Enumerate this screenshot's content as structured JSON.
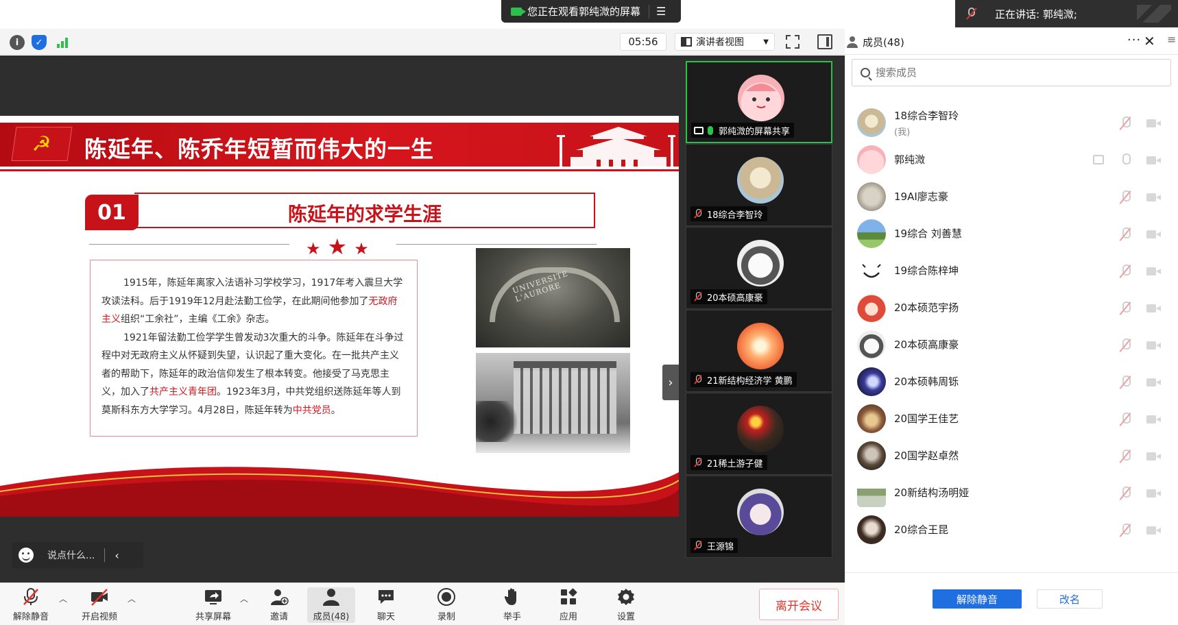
{
  "banner": {
    "viewing_text": "您正在观看郭纯溦的屏幕",
    "speaking_text": "正在讲话: 郭纯溦;"
  },
  "toolbar": {
    "timer": "05:56",
    "view_mode": "演讲者视图"
  },
  "members_panel": {
    "title": "成员(48)",
    "search_placeholder": "搜索成员",
    "members": [
      {
        "name": "18综合李智玲",
        "sub": "(我)"
      },
      {
        "name": "郭纯溦",
        "sub": ""
      },
      {
        "name": "19AI廖志豪",
        "sub": ""
      },
      {
        "name": "19综合 刘善慧",
        "sub": ""
      },
      {
        "name": "19综合陈梓坤",
        "sub": ""
      },
      {
        "name": "20本硕范宇扬",
        "sub": ""
      },
      {
        "name": "20本硕高康豪",
        "sub": ""
      },
      {
        "name": "20本硕韩周铄",
        "sub": ""
      },
      {
        "name": "20国学王佳艺",
        "sub": ""
      },
      {
        "name": "20国学赵卓然",
        "sub": ""
      },
      {
        "name": "20新结构汤明娅",
        "sub": ""
      },
      {
        "name": "20综合王昆",
        "sub": ""
      }
    ],
    "unmute_all": "解除静音",
    "rename": "改名"
  },
  "slide": {
    "title": "陈延年、陈乔年短暂而伟大的一生",
    "section_number": "01",
    "section_title": "陈延年的求学生涯",
    "para1_a": "1915年，陈延年离家入法语补习学校学习，1917年考入震旦大学攻读法科。后于1919年12月赴法勤工俭学，在此期间他参加了",
    "para1_red": "无政府主义",
    "para1_b": "组织“工余社”，主编《工余》杂志。",
    "para2_a": "1921年留法勤工俭学学生曾发动3次重大的斗争。陈延年在斗争过程中对无政府主义从怀疑到失望，认识起了重大变化。在一批共产主义者的帮助下，陈延年的政治信仰发生了根本转变。他接受了马克思主义，加入了",
    "para2_red1": "共产主义青年团",
    "para2_b": "。1923年3月，中共党组织送陈延年等人到莫斯科东方大学学习。4月28日，陈延年转为",
    "para2_red2": "中共党员",
    "para2_c": "。",
    "gate_sign": "UNIVERSITE L'AURORE"
  },
  "chat": {
    "placeholder": "说点什么..."
  },
  "tiles": [
    {
      "label": "郭纯溦的屏幕共享"
    },
    {
      "label": "18综合李智玲"
    },
    {
      "label": "20本硕高康豪"
    },
    {
      "label": "21新结构经济学 黄鹏"
    },
    {
      "label": "21稀土游子健"
    },
    {
      "label": "王源锦"
    }
  ],
  "bottombar": {
    "unmute": "解除静音",
    "video": "开启视频",
    "share": "共享屏幕",
    "invite": "邀请",
    "members": "成员(48)",
    "chat": "聊天",
    "record": "录制",
    "raise_hand": "举手",
    "apps": "应用",
    "settings": "设置",
    "leave": "离开会议"
  },
  "colors": {
    "accent": "#1f6fe0",
    "slide_red": "#c7121a",
    "speaking_green": "#2bc14a",
    "leave_red": "#e5332a"
  }
}
